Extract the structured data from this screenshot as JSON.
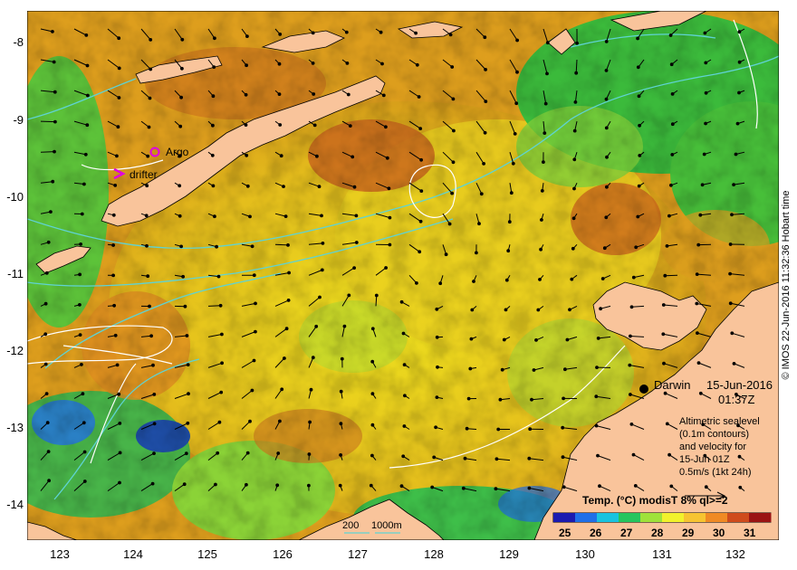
{
  "map": {
    "location_name": "Darwin",
    "date": "15-Jun-2016",
    "time": "01:37Z",
    "legend_lines": [
      "Altimetric sealevel",
      "(0.1m contours)",
      "and velocity for",
      "15-Jun 01Z",
      "0.5m/s (1kt 24h)"
    ],
    "markers": [
      {
        "label": "Argo",
        "symbol": "circle",
        "color": "#e000e0"
      },
      {
        "label": "drifter",
        "symbol": "chevron",
        "color": "#e000e0"
      }
    ],
    "depth_legend": {
      "labels": [
        "200",
        "1000m"
      ]
    },
    "credit": "© IMOS 22-Jun-2016 11:32:36 Hobart time",
    "colors": {
      "land": "#f9c49b",
      "contour": "#5fd3d3",
      "sealevel": "#ffffff"
    }
  },
  "axes": {
    "y_ticks": [
      "-8",
      "-9",
      "-10",
      "-11",
      "-12",
      "-13",
      "-14"
    ],
    "x_ticks": [
      "123",
      "124",
      "125",
      "126",
      "127",
      "128",
      "129",
      "130",
      "131",
      "132"
    ]
  },
  "colorbar": {
    "title": "Temp. (°C) modisT 8% ql>=2",
    "ticks": [
      "25",
      "26",
      "27",
      "28",
      "29",
      "30",
      "31"
    ],
    "colors": [
      "#1b1bb0",
      "#1f6fe8",
      "#19c3e0",
      "#26c55e",
      "#9fe23a",
      "#f2f22c",
      "#f7c431",
      "#f08a24",
      "#cf4b1c",
      "#9b1414"
    ]
  }
}
